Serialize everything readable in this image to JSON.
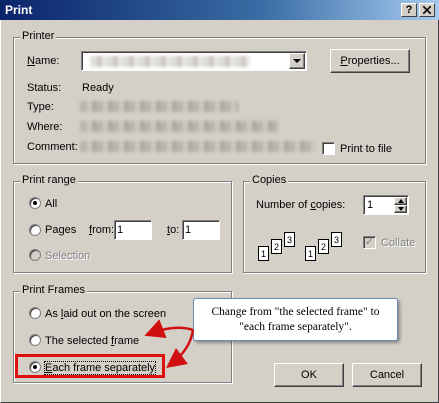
{
  "window": {
    "title": "Print",
    "help_button": "?",
    "close_button": "X"
  },
  "printer": {
    "group_label": "Printer",
    "name_label": "Name:",
    "status_label": "Status:",
    "status_value": "Ready",
    "type_label": "Type:",
    "where_label": "Where:",
    "comment_label": "Comment:",
    "properties_button": "Properties...",
    "print_to_file_label": "Print to file",
    "print_to_file_checked": false
  },
  "print_range": {
    "group_label": "Print range",
    "all_label": "All",
    "pages_label": "Pages",
    "from_label": "from:",
    "from_value": "1",
    "to_label": "to:",
    "to_value": "1",
    "selection_label": "Selection",
    "selected": "all"
  },
  "copies": {
    "group_label": "Copies",
    "number_label": "Number of copies:",
    "number_value": "1",
    "collate_label": "Collate",
    "collate_checked": true,
    "page_icons": [
      "1",
      "2",
      "3",
      "1",
      "2",
      "3"
    ]
  },
  "print_frames": {
    "group_label": "Print Frames",
    "options": [
      {
        "label": "As laid out on the screen",
        "checked": false
      },
      {
        "label": "The selected frame",
        "checked": false
      },
      {
        "label": "Each frame separately",
        "checked": true
      }
    ]
  },
  "callout": {
    "line1": "Change from \"the selected frame\" to",
    "line2": "\"each frame separately\".",
    "arrow_color": "#d01010"
  },
  "buttons": {
    "ok_label": "OK",
    "cancel_label": "Cancel"
  }
}
